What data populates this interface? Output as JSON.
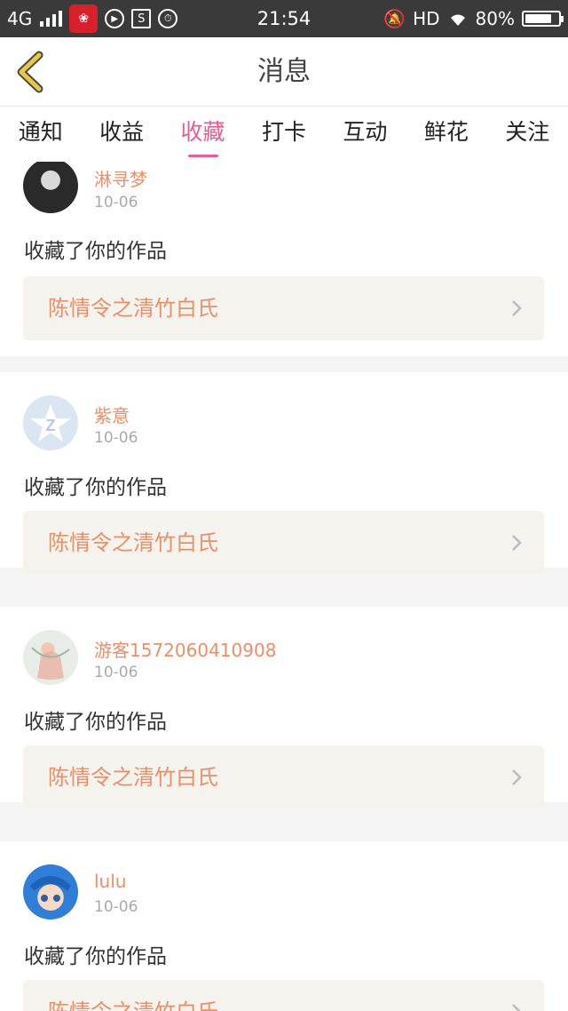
{
  "status_bar": {
    "network": "4G",
    "time": "21:54",
    "hd": "HD",
    "battery_text": "80%",
    "battery_level": 0.8
  },
  "header": {
    "title": "消息"
  },
  "tabs": [
    {
      "label": "通知",
      "active": false
    },
    {
      "label": "收益",
      "active": false
    },
    {
      "label": "收藏",
      "active": true
    },
    {
      "label": "打卡",
      "active": false
    },
    {
      "label": "互动",
      "active": false
    },
    {
      "label": "鲜花",
      "active": false
    },
    {
      "label": "关注",
      "active": false
    }
  ],
  "messages": [
    {
      "user": "淋寻梦",
      "date": "10-06",
      "text": "收藏了你的作品",
      "work_title": "陈情令之清竹白氏",
      "avatar_icon": "dark-photo-avatar"
    },
    {
      "user": "紫意",
      "date": "10-06",
      "text": "收藏了你的作品",
      "work_title": "陈情令之清竹白氏",
      "avatar_icon": "default-z-avatar"
    },
    {
      "user": "游客1572060410908",
      "date": "10-06",
      "text": "收藏了你的作品",
      "work_title": "陈情令之清竹白氏",
      "avatar_icon": "illustration-avatar"
    },
    {
      "user": "lulu",
      "date": "10-06",
      "text": "收藏了你的作品",
      "work_title": "陈情令之清竹白氏",
      "avatar_icon": "anime-avatar"
    }
  ],
  "colors": {
    "accent": "#e0609a",
    "username": "#e89068",
    "back_icon": "#e8c84a"
  }
}
